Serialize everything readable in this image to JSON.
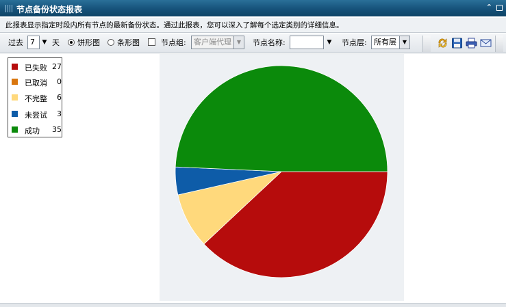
{
  "window": {
    "title": "节点备份状态报表"
  },
  "description": "此报表显示指定时段内所有节点的最新备份状态。通过此报表，您可以深入了解每个选定类别的详细信息。",
  "toolbar": {
    "past_label": "过去",
    "days_value": "7",
    "days_unit": "天",
    "pie_label": "饼形图",
    "bar_label": "条形图",
    "node_group_label": "节点组:",
    "node_group_value": "客户端代理",
    "node_name_label": "节点名称:",
    "node_name_value": "",
    "node_layer_label": "节点层:",
    "node_layer_value": "所有层",
    "chart_type_selected": "pie",
    "node_group_checked": false
  },
  "icons": [
    "refresh-icon",
    "save-icon",
    "print-icon",
    "email-icon",
    "collapse-icon",
    "restore-icon"
  ],
  "legend": [
    {
      "label": "已失败",
      "value": "27",
      "color": "#b60c0c"
    },
    {
      "label": "已取消",
      "value": "0",
      "color": "#d9760e"
    },
    {
      "label": "不完整",
      "value": "6",
      "color": "#ffd97c"
    },
    {
      "label": "未尝试",
      "value": "3",
      "color": "#0e5ca8"
    },
    {
      "label": "成功",
      "value": "35",
      "color": "#0b8a0b"
    }
  ],
  "chart_data": {
    "type": "pie",
    "categories": [
      "已失败",
      "已取消",
      "不完整",
      "未尝试",
      "成功"
    ],
    "values": [
      27,
      0,
      6,
      3,
      35
    ],
    "colors": [
      "#b60c0c",
      "#d9760e",
      "#ffd97c",
      "#0e5ca8",
      "#0b8a0b"
    ],
    "title": "",
    "legend_position": "top-left"
  }
}
